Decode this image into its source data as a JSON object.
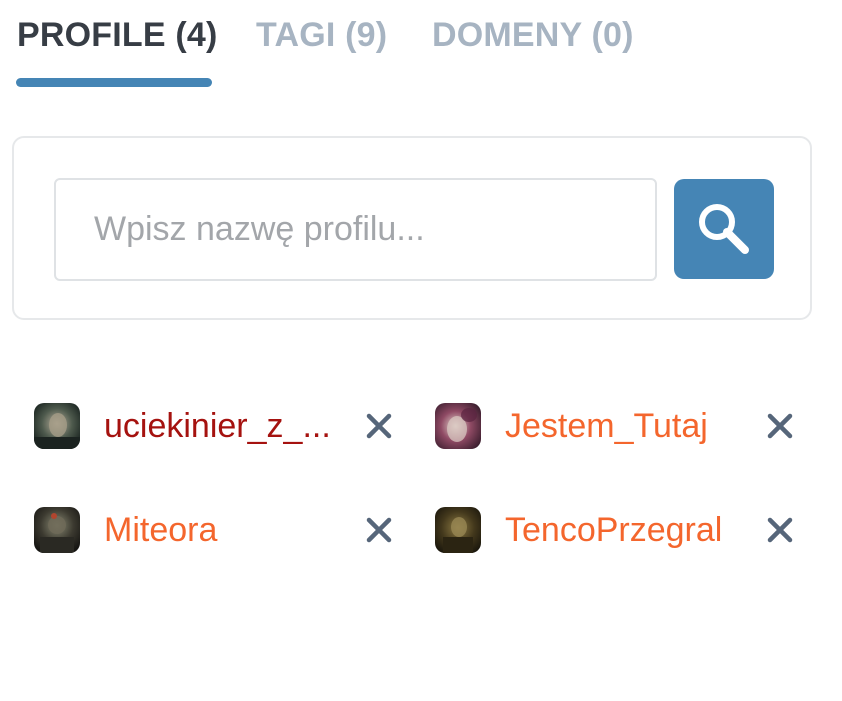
{
  "tabs": [
    {
      "label": "PROFILE (4)",
      "active": true
    },
    {
      "label": "TAGI (9)",
      "active": false
    },
    {
      "label": "DOMENY (0)",
      "active": false
    }
  ],
  "search": {
    "placeholder": "Wpisz nazwę profilu...",
    "value": "",
    "button_icon": "search-icon"
  },
  "profiles": [
    {
      "name": "uciekinier_z_...",
      "name_color": "#a5120f",
      "avatar": "avatar-image",
      "remove_icon": "close-icon"
    },
    {
      "name": "Jestem_Tutaj",
      "name_color": "#f4662d",
      "avatar": "avatar-image",
      "remove_icon": "close-icon"
    },
    {
      "name": "Miteora",
      "name_color": "#f4662d",
      "avatar": "avatar-image",
      "remove_icon": "close-icon"
    },
    {
      "name": "TencoPrzegral",
      "name_color": "#f4662d",
      "avatar": "avatar-image",
      "remove_icon": "close-icon"
    }
  ],
  "colors": {
    "accent": "#4585b5",
    "tab_active": "#373d45",
    "tab_inactive": "#a7b4c2",
    "remove_icon": "#56667a"
  }
}
